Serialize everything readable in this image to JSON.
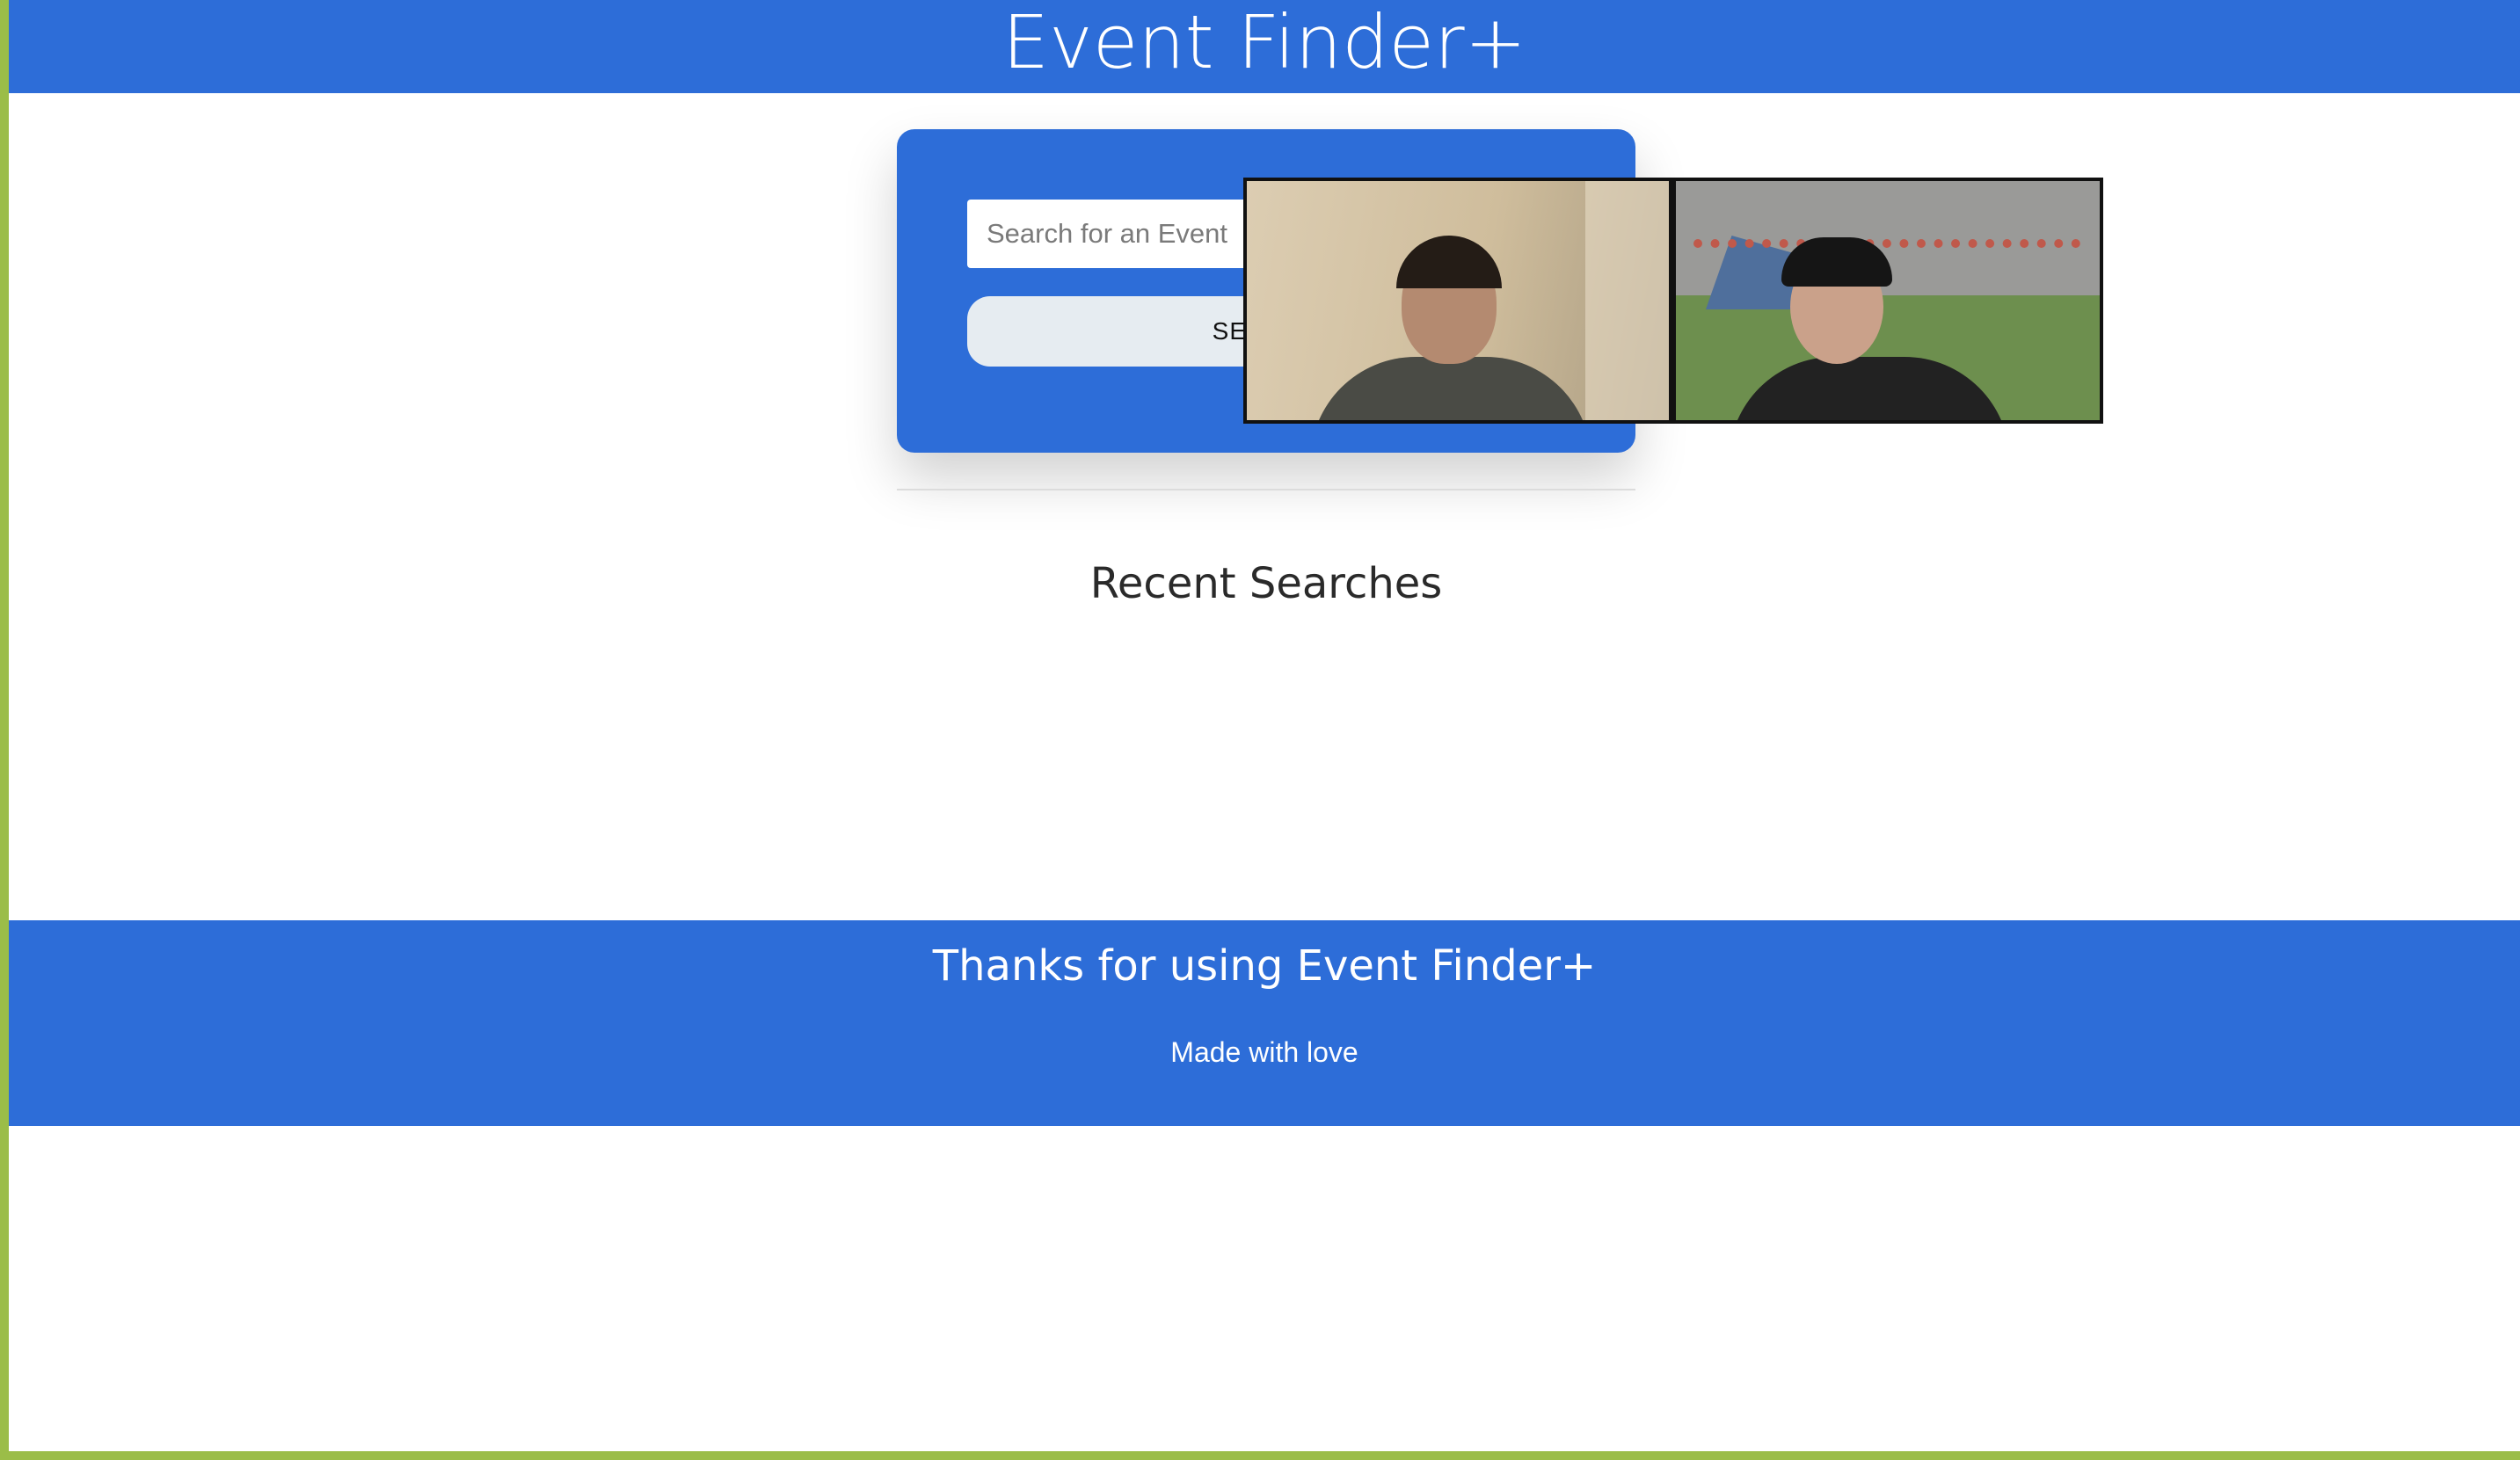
{
  "header": {
    "title": "Event Finder+"
  },
  "search": {
    "placeholder": "Search for an Event",
    "button_label": "SEARCH"
  },
  "recent": {
    "title": "Recent Searches"
  },
  "footer": {
    "title": "Thanks for using Event Finder+",
    "subtitle": "Made with love"
  },
  "colors": {
    "brand": "#2d6dd8",
    "button_bg": "#e6ecf1",
    "frame": "#9bbd48"
  },
  "video_call": {
    "participants": 2
  }
}
